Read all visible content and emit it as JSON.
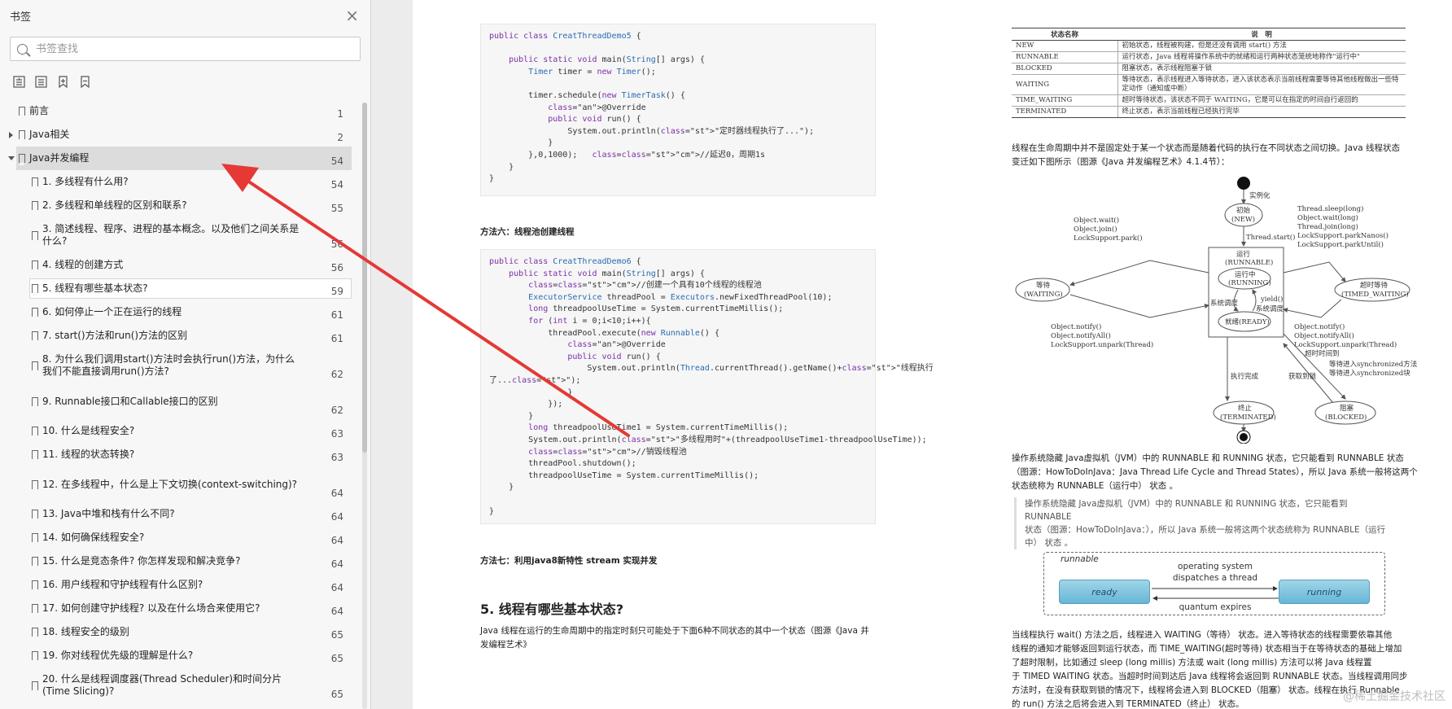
{
  "sidebar": {
    "title": "书签",
    "close_label": "×",
    "search_placeholder": "书签查找",
    "bookmarks": [
      {
        "label": "前言",
        "page": "1",
        "level": 0
      },
      {
        "label": "Java相关",
        "page": "2",
        "level": 0,
        "expander": "collapsed"
      },
      {
        "label": "Java并发编程",
        "page": "54",
        "level": 0,
        "expander": "expanded",
        "selected": true
      },
      {
        "label": "1. 多线程有什么用?",
        "page": "54",
        "level": 1
      },
      {
        "label": "2. 多线程和单线程的区别和联系?",
        "page": "55",
        "level": 1
      },
      {
        "label": "3. 简述线程、程序、进程的基本概念。以及他们之间关系是什么?",
        "page": "56",
        "level": 1
      },
      {
        "label": "4. 线程的创建方式",
        "page": "56",
        "level": 1
      },
      {
        "label": "5. 线程有哪些基本状态?",
        "page": "59",
        "level": 1,
        "focus": true
      },
      {
        "label": "6. 如何停止一个正在运行的线程",
        "page": "61",
        "level": 1
      },
      {
        "label": "7. start()方法和run()方法的区别",
        "page": "61",
        "level": 1
      },
      {
        "label": "8. 为什么我们调用start()方法时会执行run()方法，为什么我们不能直接调用run()方法?",
        "page": "62",
        "level": 1
      },
      {
        "label": "9. Runnable接口和Callable接口的区别",
        "page": "62",
        "level": 1
      },
      {
        "label": "10. 什么是线程安全?",
        "page": "63",
        "level": 1
      },
      {
        "label": "11. 线程的状态转换?",
        "page": "63",
        "level": 1
      },
      {
        "label": "12. 在多线程中，什么是上下文切换(context-switching)?",
        "page": "64",
        "level": 1
      },
      {
        "label": "13. Java中堆和栈有什么不同?",
        "page": "64",
        "level": 1
      },
      {
        "label": "14. 如何确保线程安全?",
        "page": "64",
        "level": 1
      },
      {
        "label": "15. 什么是竞态条件? 你怎样发现和解决竞争?",
        "page": "64",
        "level": 1
      },
      {
        "label": "16. 用户线程和守护线程有什么区别?",
        "page": "64",
        "level": 1
      },
      {
        "label": "17. 如何创建守护线程? 以及在什么场合来使用它?",
        "page": "64",
        "level": 1
      },
      {
        "label": "18. 线程安全的级别",
        "page": "65",
        "level": 1
      },
      {
        "label": "19. 你对线程优先级的理解是什么?",
        "page": "65",
        "level": 1
      },
      {
        "label": "20. 什么是线程调度器(Thread Scheduler)和时间分片(Time Slicing)?",
        "page": "65",
        "level": 1
      }
    ]
  },
  "doc": {
    "code1": [
      "public class CreatThreadDemo5 {",
      "",
      "    public static void main(String[] args) {",
      "        Timer timer = new Timer();",
      "",
      "        timer.schedule(new TimerTask() {",
      "            @Override",
      "            public void run() {",
      "                System.out.println(\"定时器线程执行了...\");",
      "            }",
      "        },0,1000);   //延迟0，周期1s",
      "    }",
      "}"
    ],
    "method6_title": "方法六：线程池创建线程",
    "code2": [
      "public class CreatThreadDemo6 {",
      "    public static void main(String[] args) {",
      "        //创建一个具有10个线程的线程池",
      "        ExecutorService threadPool = Executors.newFixedThreadPool(10);",
      "        long threadpoolUseTime = System.currentTimeMillis();",
      "        for (int i = 0;i<10;i++){",
      "            threadPool.execute(new Runnable() {",
      "                @Override",
      "                public void run() {",
      "                    System.out.println(Thread.currentThread().getName()+\"线程执行",
      "了...\");",
      "                }",
      "            });",
      "        }",
      "        long threadpoolUseTime1 = System.currentTimeMillis();",
      "        System.out.println(\"多线程用时\"+(threadpoolUseTime1-threadpoolUseTime));",
      "        //销毁线程池",
      "        threadPool.shutdown();",
      "        threadpoolUseTime = System.currentTimeMillis();",
      "    }",
      "",
      "}"
    ],
    "method7_title": "方法七：利用java8新特性 stream 实现并发",
    "section5_title": "5. 线程有哪些基本状态?",
    "section5_text_1": "Java 线程在运行的生命周期中的指定时刻只可能处于下面6种不同状态的其中一个状态（图源《Java 并",
    "section5_text_2": "发编程艺术》",
    "table": {
      "headers": [
        "状态名称",
        "说　明"
      ],
      "rows": [
        [
          "NEW",
          "初始状态，线程被构建，但是还没有调用 start() 方法"
        ],
        [
          "RUNNABLE",
          "运行状态，Java 线程将操作系统中的就绪和运行两种状态笼统地称作\"运行中\""
        ],
        [
          "BLOCKED",
          "阻塞状态，表示线程阻塞于锁"
        ],
        [
          "WAITING",
          "等待状态，表示线程进入等待状态，进入该状态表示当前线程需要等待其他线程做出一些特定动作（通知或中断）"
        ],
        [
          "TIME_WAITING",
          "超时等待状态，该状态不同于 WAITING，它是可以在指定的时间自行返回的"
        ],
        [
          "TERMINATED",
          "终止状态，表示当前线程已经执行完毕"
        ]
      ]
    },
    "para1_1": "线程在生命周期中并不是固定处于某一个状态而是随着代码的执行在不同状态之间切换。Java 线程状态",
    "para1_2": "变迁如下图所示（图源《Java 并发编程艺术》4.1.4节）：",
    "diagram": {
      "instantiate": "实例化",
      "new_zh": "初始",
      "new_en": "(NEW)",
      "thread_start": "Thread.start()",
      "run_zh": "运行",
      "runnable_en": "(RUNNABLE)",
      "running_zh": "运行中",
      "running_en": "(RUNNING)",
      "yield": "yield()",
      "sched": "系统调度",
      "sched2": "系统调度",
      "ready": "就绪(READY)",
      "waiting_zh": "等待",
      "waiting_en": "(WAITING)",
      "timed_zh": "超时等待",
      "timed_en": "(TIMED_WAITING)",
      "w_in": [
        "Object.wait()",
        "Object.join()",
        "LockSupport.park()"
      ],
      "w_out": [
        "Object.notify()",
        "Object.notifyAll()",
        "LockSupport.unpark(Thread)"
      ],
      "t_in": [
        "Thread.sleep(long)",
        "Object.wait(long)",
        "Thread.join(long)",
        "LockSupport.parkNanos()",
        "LockSupport.parkUntil()"
      ],
      "t_out": [
        "Object.notify()",
        "Object.notifyAll()",
        "LockSupport.unpark(Thread)",
        "超时时间到"
      ],
      "sync1": "等待进入synchronized方法",
      "sync2": "等待进入synchronized块",
      "got_lock": "获取到锁",
      "exec_done": "执行完成",
      "term_zh": "终止",
      "term_en": "(TERMINATED)",
      "blocked_zh": "阻塞",
      "blocked_en": "(BLOCKED)"
    },
    "para2_1": "操作系统隐藏 Java虚拟机（JVM）中的 RUNNABLE 和 RUNNING 状态，它只能看到 RUNNABLE 状态",
    "para2_2": "（图源：HowToDoInJava：Java Thread Life Cycle and Thread States），所以 Java 系统一般将这两个",
    "para2_3": "状态统称为 RUNNABLE（运行中） 状态 。",
    "quote_1": "操作系统隐藏 Java虚拟机（JVM）中的 RUNNABLE 和 RUNNING 状态，它只能看到 RUNNABLE",
    "quote_2": "状态（图源：HowToDoInJava：），所以 Java 系统一般将这两个状态统称为 RUNNABLE（运行",
    "quote_3": "中） 状态 。",
    "rr": {
      "tag": "runnable",
      "ready": "ready",
      "running": "running",
      "dispatch_1": "operating system",
      "dispatch_2": "dispatches a thread",
      "expire": "quantum expires"
    },
    "para3_1": "当线程执行 wait() 方法之后，线程进入 WAITING（等待） 状态。进入等待状态的线程需要依靠其他",
    "para3_2": "线程的通知才能够返回到运行状态，而 TIME_WAITING(超时等待) 状态相当于在等待状态的基础上增加",
    "para3_3": "了超时限制，比如通过 sleep (long millis) 方法或 wait (long millis) 方法可以将 Java 线程置",
    "para3_4": "于 TIMED WAITING 状态。当超时时间到达后 Java 线程将会返回到 RUNNABLE 状态。当线程调用同步",
    "para3_5": "方法时，在没有获取到锁的情况下，线程将会进入到 BLOCKED（阻塞） 状态。线程在执行 Runnable",
    "para3_6": "的 run() 方法之后将会进入到 TERMINATED（终止） 状态。",
    "watermark": "@稀土掘金技术社区"
  },
  "colors": {
    "annotation_arrow": "#e53935",
    "selected_row": "#dcdcdc"
  }
}
